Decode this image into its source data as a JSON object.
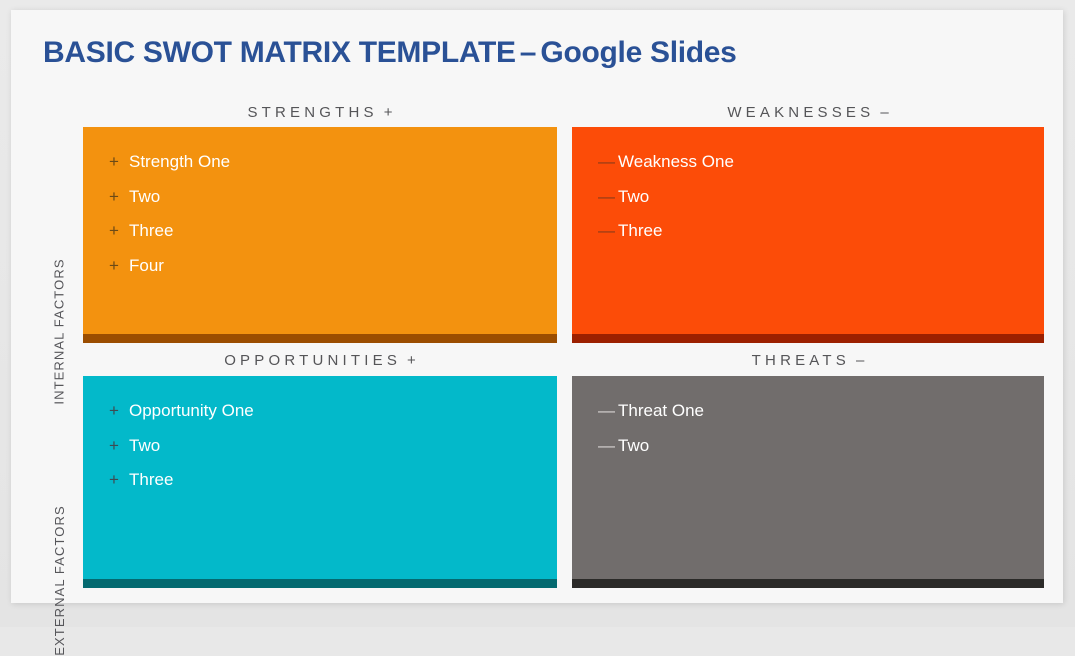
{
  "title": {
    "main": "BASIC SWOT MATRIX TEMPLATE",
    "separator": "–",
    "suffix": "Google Slides"
  },
  "colors": {
    "title": "#2a5196",
    "page_background": "#e8e8e8",
    "card_background": "#f7f7f7",
    "strengths_fill": "#f3920f",
    "strengths_accent": "#9b4d00",
    "weaknesses_fill": "#fc4c08",
    "weaknesses_accent": "#9c2000",
    "opportunities_fill": "#03b9ca",
    "opportunities_accent": "#046a70",
    "threats_fill": "#716d6c",
    "threats_accent": "#2b2a28",
    "header_text": "#555558"
  },
  "side_labels": {
    "internal": "INTERNAL FACTORS",
    "external": "EXTERNAL FACTORS"
  },
  "quadrants": {
    "strengths": {
      "heading": "STRENGTHS",
      "sign": "+",
      "bullet": "+",
      "items": [
        "Strength One",
        "Two",
        "Three",
        "Four"
      ]
    },
    "weaknesses": {
      "heading": "WEAKNESSES",
      "sign": "–",
      "bullet": "—",
      "items": [
        "Weakness One",
        "Two",
        "Three"
      ]
    },
    "opportunities": {
      "heading": "OPPORTUNITIES",
      "sign": "+",
      "bullet": "+",
      "items": [
        "Opportunity One",
        "Two",
        "Three"
      ]
    },
    "threats": {
      "heading": "THREATS",
      "sign": "–",
      "bullet": "—",
      "items": [
        "Threat One",
        "Two"
      ]
    }
  }
}
